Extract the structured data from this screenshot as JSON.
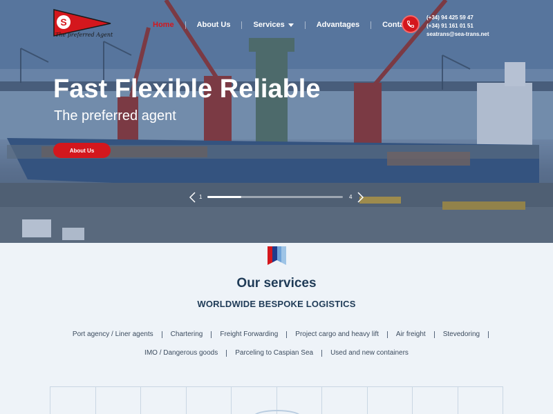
{
  "logo": {
    "tagline": "The preferred Agent",
    "badge_letter": "S"
  },
  "nav": {
    "items": [
      {
        "label": "Home",
        "active": true
      },
      {
        "label": "About Us",
        "active": false
      },
      {
        "label": "Services",
        "active": false,
        "dropdown": true
      },
      {
        "label": "Advantages",
        "active": false
      },
      {
        "label": "Contact",
        "active": false
      }
    ]
  },
  "contact": {
    "phone1": "(+34) 94 425 59 47",
    "phone2": "(+34) 91 161 01 51",
    "email": "seatrans@sea-trans.net",
    "icon": "phone-icon"
  },
  "hero": {
    "title": "Fast Flexible Reliable",
    "subtitle": "The preferred agent",
    "button_label": "About Us"
  },
  "slider": {
    "current": "1",
    "total": "4",
    "progress": 0.25
  },
  "services": {
    "title": "Our services",
    "subtitle": "WORLDWIDE BESPOKE LOGISTICS",
    "row1": [
      "Port agency / Liner agents",
      "Chartering",
      "Freight Forwarding",
      "Project cargo and heavy lift",
      "Air freight",
      "Stevedoring"
    ],
    "row2": [
      "IMO / Dangerous goods",
      "Parceling to Caspian Sea",
      "Used and new containers"
    ]
  },
  "colors": {
    "accent": "#d4171d",
    "navy": "#1f3b57",
    "page_bg": "#eef3f8"
  }
}
